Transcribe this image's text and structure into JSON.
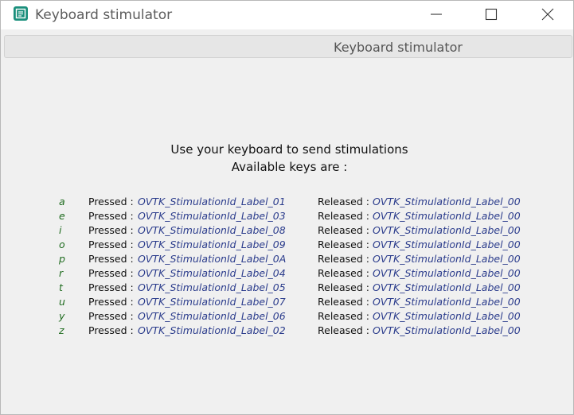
{
  "window": {
    "title": "Keyboard stimulator",
    "icon": "app-window-icon",
    "accent_color": "#1a8f7c"
  },
  "tab": {
    "label": "Keyboard stimulator"
  },
  "instructions": {
    "line1": "Use your keyboard to send stimulations",
    "line2": "Available keys are :"
  },
  "key_mappings": [
    {
      "key": "a",
      "pressed_label": "Pressed :",
      "pressed": "OVTK_StimulationId_Label_01",
      "released_label": "Released :",
      "released": "OVTK_StimulationId_Label_00"
    },
    {
      "key": "e",
      "pressed_label": "Pressed :",
      "pressed": "OVTK_StimulationId_Label_03",
      "released_label": "Released :",
      "released": "OVTK_StimulationId_Label_00"
    },
    {
      "key": "i",
      "pressed_label": "Pressed :",
      "pressed": "OVTK_StimulationId_Label_08",
      "released_label": "Released :",
      "released": "OVTK_StimulationId_Label_00"
    },
    {
      "key": "o",
      "pressed_label": "Pressed :",
      "pressed": "OVTK_StimulationId_Label_09",
      "released_label": "Released :",
      "released": "OVTK_StimulationId_Label_00"
    },
    {
      "key": "p",
      "pressed_label": "Pressed :",
      "pressed": "OVTK_StimulationId_Label_0A",
      "released_label": "Released :",
      "released": "OVTK_StimulationId_Label_00"
    },
    {
      "key": "r",
      "pressed_label": "Pressed :",
      "pressed": "OVTK_StimulationId_Label_04",
      "released_label": "Released :",
      "released": "OVTK_StimulationId_Label_00"
    },
    {
      "key": "t",
      "pressed_label": "Pressed :",
      "pressed": "OVTK_StimulationId_Label_05",
      "released_label": "Released :",
      "released": "OVTK_StimulationId_Label_00"
    },
    {
      "key": "u",
      "pressed_label": "Pressed :",
      "pressed": "OVTK_StimulationId_Label_07",
      "released_label": "Released :",
      "released": "OVTK_StimulationId_Label_00"
    },
    {
      "key": "y",
      "pressed_label": "Pressed :",
      "pressed": "OVTK_StimulationId_Label_06",
      "released_label": "Released :",
      "released": "OVTK_StimulationId_Label_00"
    },
    {
      "key": "z",
      "pressed_label": "Pressed :",
      "pressed": "OVTK_StimulationId_Label_02",
      "released_label": "Released :",
      "released": "OVTK_StimulationId_Label_00"
    }
  ]
}
